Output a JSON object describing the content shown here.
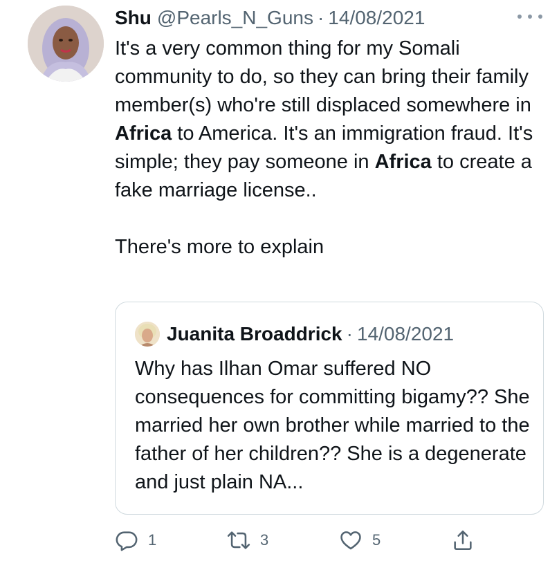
{
  "tweet": {
    "author_name": "Shu",
    "author_handle": "@Pearls_N_Guns",
    "separator": "·",
    "date": "14/08/2021",
    "body": {
      "p1_a": "It's a very common thing for my Somali community to do, so they can bring their family member(s) who're still displaced somewhere in ",
      "p1_b": "Africa",
      "p1_c": " to America. It's an immigration fraud. It's simple; they pay someone in ",
      "p1_d": "Africa",
      "p1_e": " to create a fake marriage license..",
      "p2": "There's more to explain"
    }
  },
  "quoted": {
    "author_name": "Juanita Broaddrick",
    "separator": "·",
    "date": "14/08/2021",
    "body": "Why has Ilhan Omar suffered NO consequences for committing bigamy?? She married her own brother while married to the father of her children?? She is a degenerate and just plain NA..."
  },
  "actions": {
    "reply_count": "1",
    "retweet_count": "3",
    "like_count": "5"
  },
  "icons": {
    "more": "more-dots-icon",
    "reply": "reply-icon",
    "retweet": "retweet-icon",
    "like": "heart-icon",
    "share": "share-icon"
  },
  "colors": {
    "text": "#0f1419",
    "secondary": "#536471",
    "border": "#cfd9de"
  }
}
